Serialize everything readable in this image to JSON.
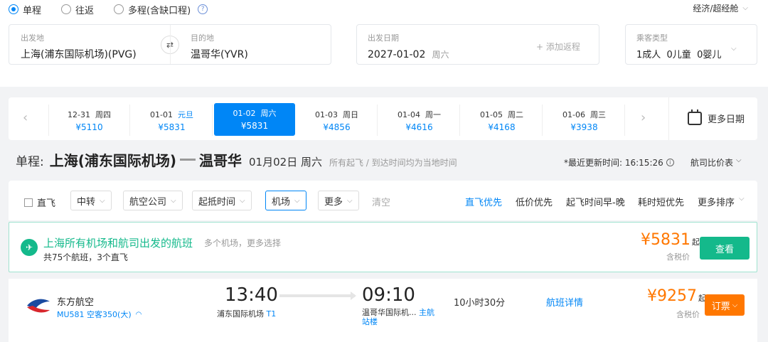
{
  "trip_types": {
    "one_way": "单程",
    "round_trip": "往返",
    "multi": "多程(含缺口程)"
  },
  "cabin": "经济/超经舱",
  "search": {
    "from_label": "出发地",
    "from_value": "上海(浦东国际机场)(PVG)",
    "to_label": "目的地",
    "to_value": "温哥华(YVR)",
    "date_label": "出发日期",
    "date_value": "2027-01-02",
    "date_weekday": "周六",
    "add_return": "+ 添加返程",
    "passenger_label": "乘客类型",
    "passengers": "1成人  0儿童  0婴儿"
  },
  "dates": [
    {
      "date": "12-31",
      "day": "周四",
      "price": "¥5110",
      "holiday": ""
    },
    {
      "date": "01-01",
      "day": "",
      "price": "¥5831",
      "holiday": "元旦"
    },
    {
      "date": "01-02",
      "day": "周六",
      "price": "¥5831",
      "holiday": ""
    },
    {
      "date": "01-03",
      "day": "周日",
      "price": "¥4856",
      "holiday": ""
    },
    {
      "date": "01-04",
      "day": "周一",
      "price": "¥4616",
      "holiday": ""
    },
    {
      "date": "01-05",
      "day": "周二",
      "price": "¥4168",
      "holiday": ""
    },
    {
      "date": "01-06",
      "day": "周三",
      "price": "¥3938",
      "holiday": ""
    }
  ],
  "more_dates": "更多日期",
  "route": {
    "prefix": "单程:",
    "from_city": "上海(浦东国际机场)",
    "to_city": "温哥华",
    "date": "01月02日 周六",
    "note": "所有起飞 / 到达时间均为当地时间",
    "updated": "*最近更新时间: 16:15:26",
    "price_table": "航司比价表"
  },
  "filters": {
    "direct": "直飞",
    "transfer": "中转",
    "airline": "航空公司",
    "time": "起抵时间",
    "airport": "机场",
    "more": "更多",
    "clear": "清空"
  },
  "sorts": {
    "direct_first": "直飞优先",
    "low_price": "低价优先",
    "early": "起飞时间早-晚",
    "short": "耗时短优先",
    "more_sort": "更多排序"
  },
  "banner": {
    "title": "上海所有机场和航司出发的航班",
    "subtitle": "共75个航班，3个直飞",
    "hint": "多个机场，更多选择",
    "price": "¥5831",
    "price_suffix": "起",
    "tax": "含税价",
    "button": "查看"
  },
  "flight": {
    "airline": "东方航空",
    "flight_no": "MU581 空客350(大)",
    "dep_time": "13:40",
    "dep_airport": "浦东国际机场",
    "dep_terminal": "T1",
    "arr_time": "09:10",
    "arr_airport": "温哥华国际机...",
    "arr_terminal": "主航站楼",
    "duration": "10小时30分",
    "details": "航班详情",
    "price": "¥9257",
    "price_suffix": "起",
    "tax": "含税价",
    "book": "订票"
  },
  "colors": {
    "primary": "#0086f6",
    "green": "#14b98b",
    "orange": "#ff7700"
  }
}
